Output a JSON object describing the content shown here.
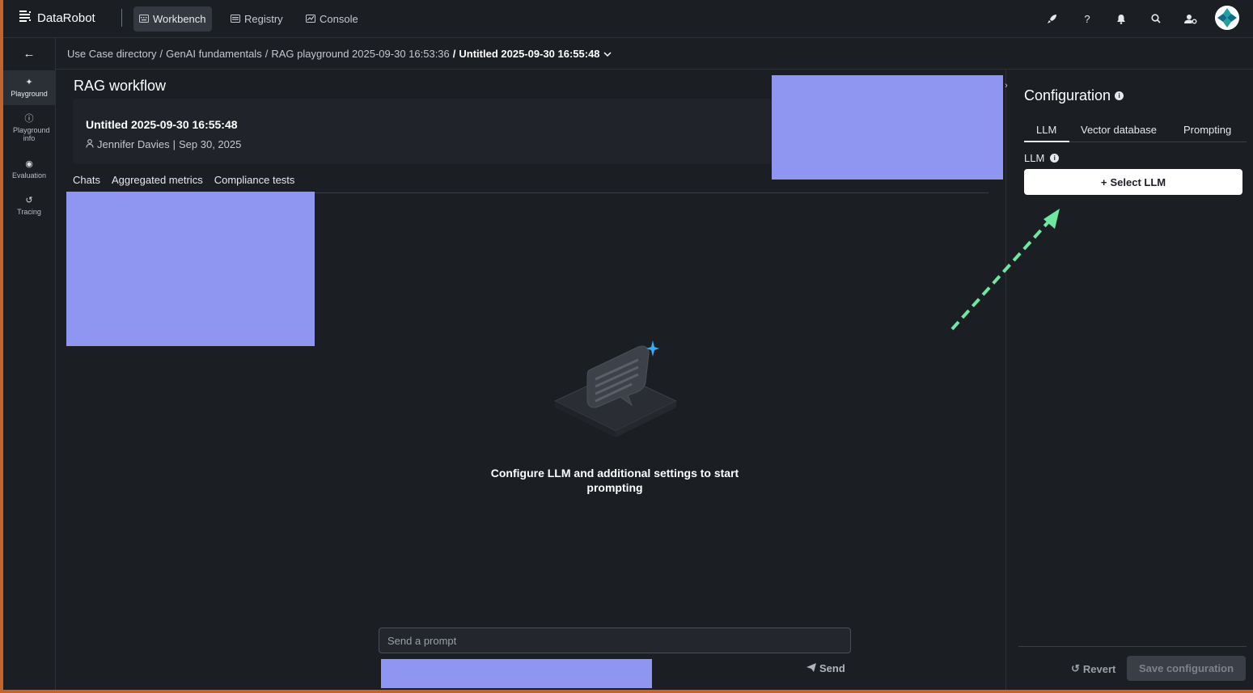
{
  "app": {
    "brand": "DataRobot",
    "nav": [
      {
        "label": "Workbench",
        "icon": "keyboard-icon",
        "active": true
      },
      {
        "label": "Registry",
        "icon": "list-icon",
        "active": false
      },
      {
        "label": "Console",
        "icon": "chart-icon",
        "active": false
      }
    ],
    "top_icons": [
      "rocket-icon",
      "help-icon",
      "bell-icon",
      "search-icon",
      "user-settings-icon",
      "avatar"
    ]
  },
  "rail": {
    "items": [
      {
        "label": "Playground",
        "icon": "sparkle-icon",
        "active": true
      },
      {
        "label": "Playground info",
        "icon": "info-icon",
        "active": false
      },
      {
        "label": "Evaluation",
        "icon": "target-icon",
        "active": false
      },
      {
        "label": "Tracing",
        "icon": "history-icon",
        "active": false
      }
    ]
  },
  "breadcrumb": {
    "items": [
      "Use Case directory",
      "GenAI fundamentals",
      "RAG playground 2025-09-30 16:53:36"
    ],
    "current": "Untitled 2025-09-30 16:55:48"
  },
  "main": {
    "title": "RAG workflow",
    "card": {
      "title": "Untitled 2025-09-30 16:55:48",
      "author": "Jennifer Davies",
      "date": "Sep 30, 2025"
    },
    "tabs": [
      "Chats",
      "Aggregated metrics",
      "Compliance tests"
    ],
    "empty_state": "Configure LLM and additional settings to start prompting",
    "prompt_placeholder": "Send a prompt",
    "send_label": "Send"
  },
  "panel": {
    "title": "Configuration",
    "tabs": [
      "LLM",
      "Vector database",
      "Prompting"
    ],
    "active_tab": "LLM",
    "llm_label": "LLM",
    "select_llm": "Select LLM",
    "revert": "Revert",
    "save": "Save configuration"
  },
  "colors": {
    "background": "#1b1e23",
    "redaction": "#8f96f2",
    "arrow": "#6ee7a0",
    "accent_star": "#3aa8f5"
  }
}
